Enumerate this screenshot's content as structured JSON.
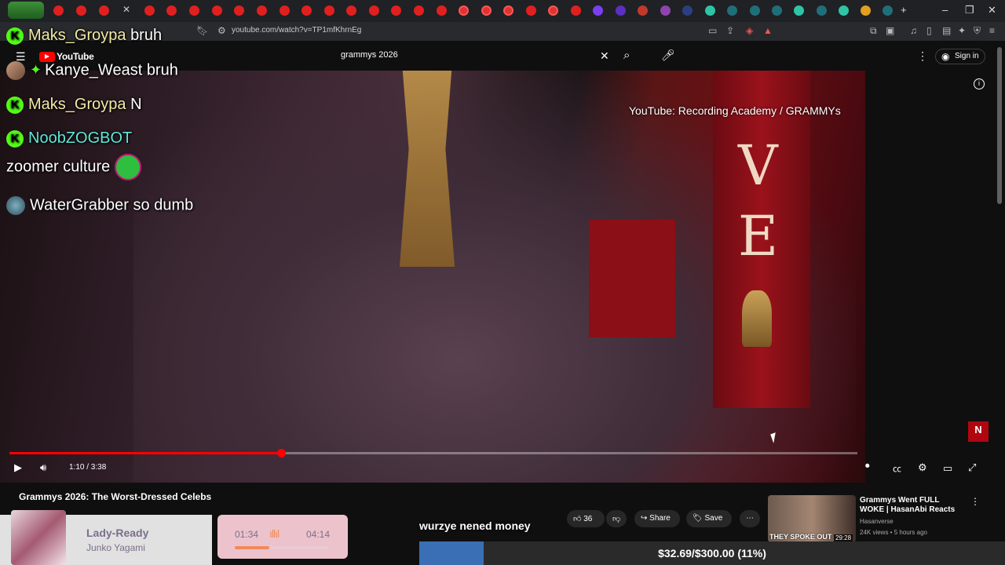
{
  "browser": {
    "url": "youtube.com/watch?v=TP1mfKhrnEg"
  },
  "youtube": {
    "logo_text": "YouTube",
    "search_value": "grammys 2026",
    "signin_label": "Sign in"
  },
  "video": {
    "credit": "YouTube: Recording Academy / GRAMMYs",
    "banner_letters": [
      "V",
      "E"
    ],
    "time_display": "1:10 / 3:38",
    "progress_fraction": 0.32,
    "title": "Grammys 2026: The Worst-Dressed Celebs"
  },
  "chat": [
    {
      "user": "Maks_Groypa",
      "msg": "bruh",
      "badge": "K",
      "user_color": "#f2e9a6"
    },
    {
      "user": "Kanye_Weast",
      "msg": "bruh",
      "badge": "avatar",
      "user_color": "#ffffff"
    },
    {
      "user": "Maks_Groypa",
      "msg": "N",
      "badge": "K",
      "user_color": "#f2e9a6"
    },
    {
      "user": "NoobZOGBOT",
      "msg": "",
      "badge": "K",
      "user_color": "#5ee8d9"
    },
    {
      "user": "",
      "msg": "zoomer culture",
      "badge": "",
      "user_color": "#ffffff"
    },
    {
      "user": "WaterGrabber",
      "msg": "so dumb",
      "badge": "avatar",
      "user_color": "#ffffff"
    }
  ],
  "actions": {
    "likes": "36",
    "share": "Share",
    "save": "Save"
  },
  "suggestion": {
    "title": "Grammys Went FULL WOKE | HasanAbi Reacts",
    "channel": "Hasanverse",
    "meta": "24K views • 5 hours ago",
    "duration": "29:28",
    "thumb_text": "THEY SPOKE OUT"
  },
  "music": {
    "title": "Lady-Ready",
    "artist": "Junko Yagami",
    "elapsed": "01:34",
    "total": "04:14",
    "progress_fraction": 0.37
  },
  "overlay": {
    "caption": "wurzye nened money",
    "goal_text": "$32.69/$300.00 (11%)",
    "goal_fraction": 0.11,
    "netflix_badge": "N"
  },
  "colors": {
    "accent_red": "#ff0000",
    "kick_green": "#53fc18"
  }
}
